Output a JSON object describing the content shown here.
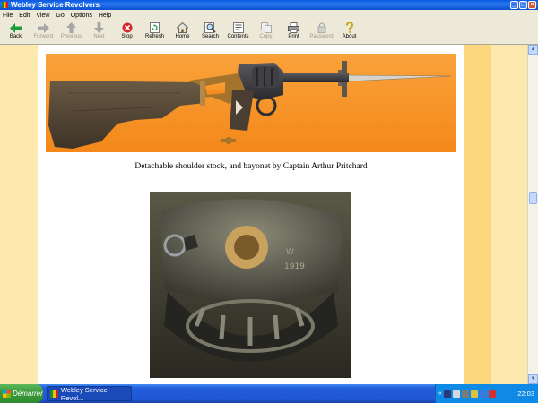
{
  "window": {
    "title": "Webley Service Revolvers"
  },
  "menu": [
    "File",
    "Edit",
    "View",
    "Go",
    "Options",
    "Help"
  ],
  "toolbar": [
    {
      "label": "Back",
      "icon": "back-arrow-icon",
      "enabled": true
    },
    {
      "label": "Forward",
      "icon": "forward-arrow-icon",
      "enabled": false
    },
    {
      "label": "Previous",
      "icon": "previous-arrow-icon",
      "enabled": false
    },
    {
      "label": "Next",
      "icon": "next-arrow-icon",
      "enabled": false
    },
    {
      "label": "Stop",
      "icon": "stop-icon",
      "enabled": true
    },
    {
      "label": "Refresh",
      "icon": "refresh-icon",
      "enabled": true
    },
    {
      "label": "Home",
      "icon": "home-icon",
      "enabled": true
    },
    {
      "label": "Search",
      "icon": "search-icon",
      "enabled": true
    },
    {
      "label": "Contents",
      "icon": "contents-icon",
      "enabled": true
    },
    {
      "label": "Copy",
      "icon": "copy-icon",
      "enabled": false
    },
    {
      "label": "Print",
      "icon": "print-icon",
      "enabled": true
    },
    {
      "label": "Password",
      "icon": "password-icon",
      "enabled": false
    },
    {
      "label": "About",
      "icon": "about-icon",
      "enabled": true
    }
  ],
  "content": {
    "caption": "Detachable shoulder stock, and bayonet by Captain Arthur Pritchard",
    "photo2_markings": [
      "W",
      "1919"
    ]
  },
  "taskbar": {
    "start_label": "Démarrer",
    "task_label": "Webley Service Revol...",
    "clock": "22:03",
    "tray_chevron": "«"
  },
  "colors": {
    "page_bg": "#ffffff",
    "margin_bg": "#fde9ae",
    "band_bg": "#fcd77d",
    "photo1_bg": "#f7931e"
  }
}
